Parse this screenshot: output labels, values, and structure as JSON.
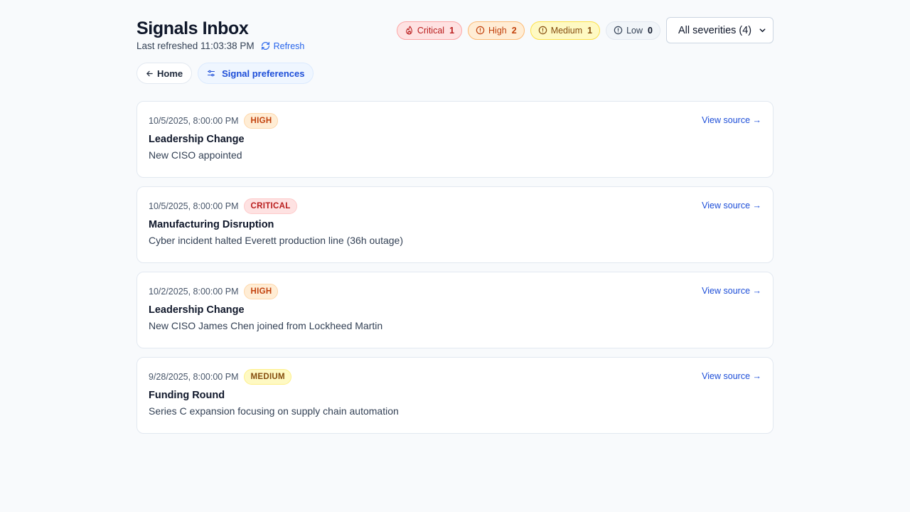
{
  "header": {
    "title": "Signals Inbox",
    "last_refreshed": "Last refreshed 11:03:38 PM",
    "refresh_label": "Refresh"
  },
  "severity_counts": [
    {
      "key": "critical",
      "label": "Critical",
      "count": "1",
      "icon": "flame-icon"
    },
    {
      "key": "high",
      "label": "High",
      "count": "2",
      "icon": "alert-circle-icon"
    },
    {
      "key": "medium",
      "label": "Medium",
      "count": "1",
      "icon": "alert-circle-icon"
    },
    {
      "key": "low",
      "label": "Low",
      "count": "0",
      "icon": "alert-circle-icon"
    }
  ],
  "filter": {
    "selected": "All severities (4)"
  },
  "nav": {
    "home_label": "Home",
    "prefs_label": "Signal preferences"
  },
  "signals": [
    {
      "date": "10/5/2025, 8:00:00 PM",
      "severity": "HIGH",
      "severity_key": "high",
      "title": "Leadership Change",
      "description": "New CISO appointed",
      "link": "View source →"
    },
    {
      "date": "10/5/2025, 8:00:00 PM",
      "severity": "CRITICAL",
      "severity_key": "critical",
      "title": "Manufacturing Disruption",
      "description": "Cyber incident halted Everett production line (36h outage)",
      "link": "View source →"
    },
    {
      "date": "10/2/2025, 8:00:00 PM",
      "severity": "HIGH",
      "severity_key": "high",
      "title": "Leadership Change",
      "description": "New CISO James Chen joined from Lockheed Martin",
      "link": "View source →"
    },
    {
      "date": "9/28/2025, 8:00:00 PM",
      "severity": "MEDIUM",
      "severity_key": "medium",
      "title": "Funding Round",
      "description": "Series C expansion focusing on supply chain automation",
      "link": "View source →"
    }
  ],
  "colors": {
    "accent": "#2563eb",
    "critical": "#b91c1c",
    "high": "#c2410c",
    "medium": "#854d0e"
  }
}
